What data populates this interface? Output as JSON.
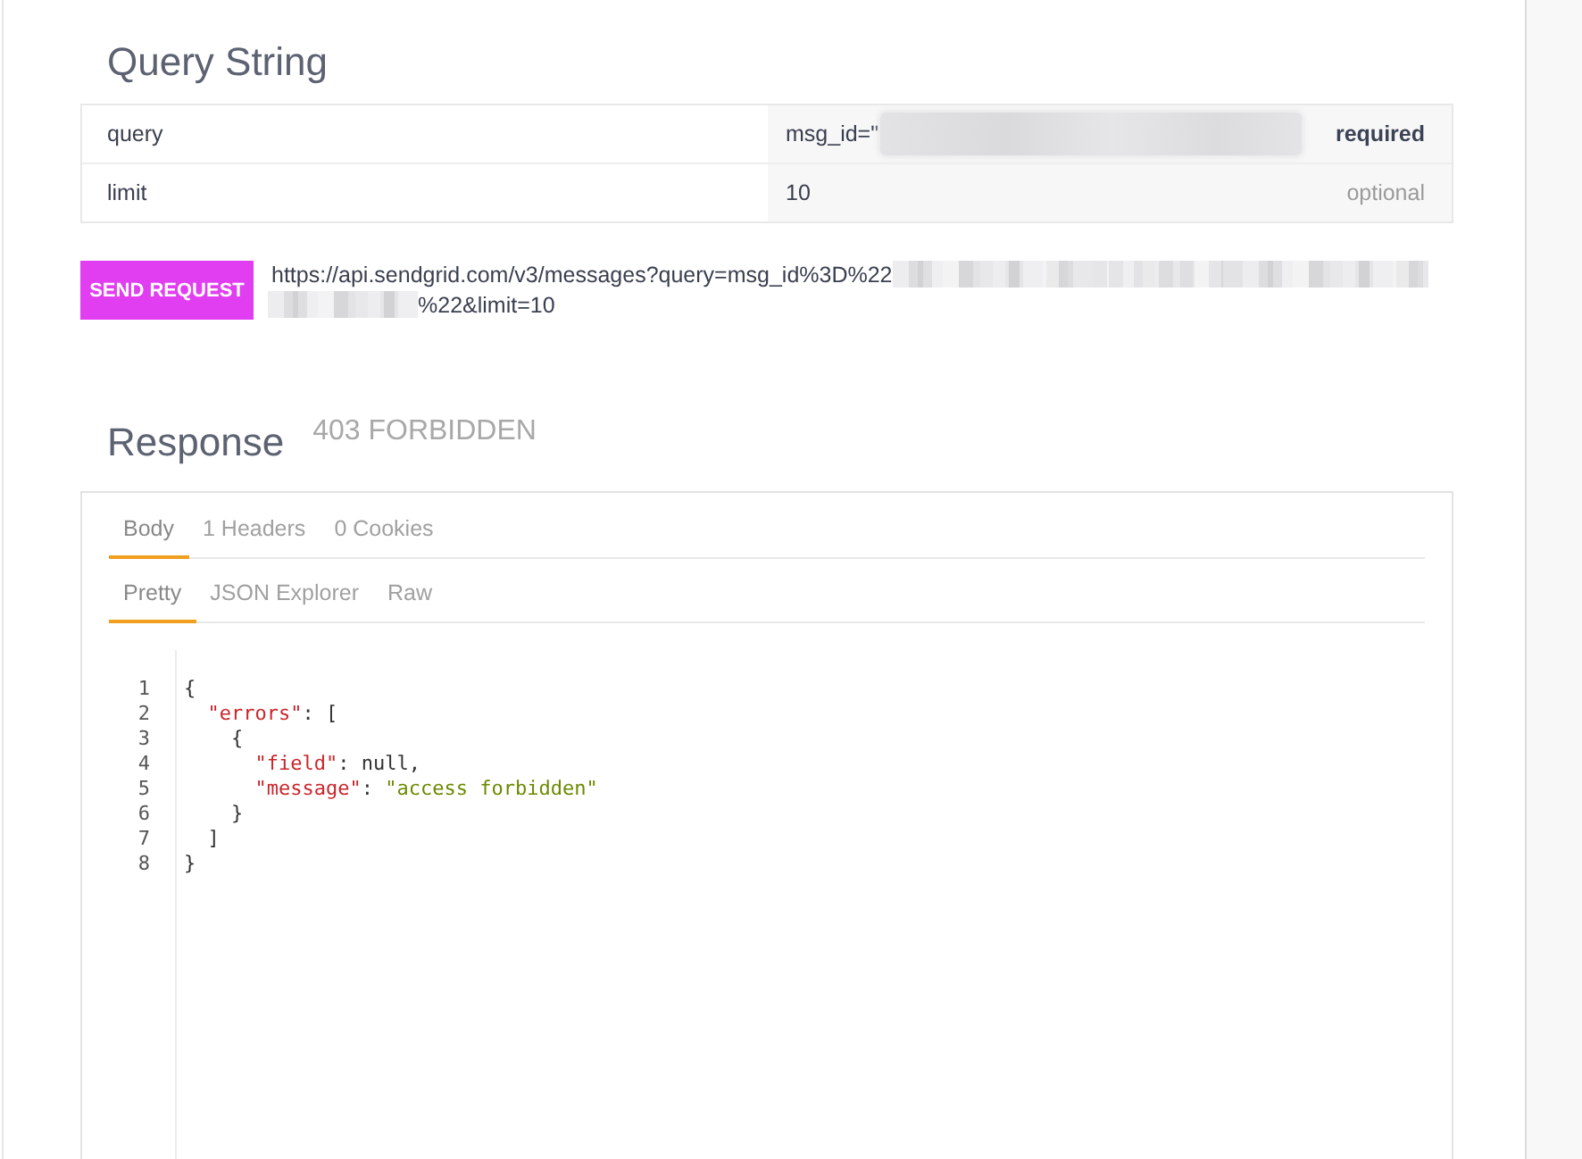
{
  "query_string": {
    "title": "Query String",
    "params": [
      {
        "name": "query",
        "value": "msg_id=\"",
        "redacted": true,
        "requirement": "required",
        "required": true
      },
      {
        "name": "limit",
        "value": "10",
        "redacted": false,
        "requirement": "optional",
        "required": false
      }
    ]
  },
  "request": {
    "button": "SEND REQUEST",
    "url_lines": [
      [
        {
          "kind": "text",
          "text": "https://api.sendgrid.com/v3/messages?query=msg_id%3D%22"
        },
        {
          "kind": "redacted"
        }
      ],
      [
        {
          "kind": "redacted"
        },
        {
          "kind": "text",
          "text": "%22&limit=10"
        }
      ]
    ]
  },
  "response": {
    "title": "Response",
    "status": "403 FORBIDDEN",
    "tabs": [
      {
        "label": "Body",
        "selected": true
      },
      {
        "label": "1 Headers",
        "selected": false
      },
      {
        "label": "0 Cookies",
        "selected": false
      }
    ],
    "view_tabs": [
      {
        "label": "Pretty",
        "selected": true
      },
      {
        "label": "JSON Explorer",
        "selected": false
      },
      {
        "label": "Raw",
        "selected": false
      }
    ],
    "code": {
      "lines": [
        {
          "number": "1",
          "tokens": [
            {
              "kind": "punct",
              "text": "{"
            }
          ]
        },
        {
          "number": "2",
          "tokens": [
            {
              "kind": "key",
              "text": "  \"errors\""
            },
            {
              "kind": "punct",
              "text": ": ["
            }
          ]
        },
        {
          "number": "3",
          "tokens": [
            {
              "kind": "punct",
              "text": "    {"
            }
          ]
        },
        {
          "number": "4",
          "tokens": [
            {
              "kind": "key",
              "text": "      \"field\""
            },
            {
              "kind": "punct",
              "text": ": null,"
            }
          ]
        },
        {
          "number": "5",
          "tokens": [
            {
              "kind": "key",
              "text": "      \"message\""
            },
            {
              "kind": "punct",
              "text": ": "
            },
            {
              "kind": "string",
              "text": "\"access forbidden\""
            }
          ]
        },
        {
          "number": "6",
          "tokens": [
            {
              "kind": "punct",
              "text": "    }"
            }
          ]
        },
        {
          "number": "7",
          "tokens": [
            {
              "kind": "punct",
              "text": "  ]"
            }
          ]
        },
        {
          "number": "8",
          "tokens": [
            {
              "kind": "punct",
              "text": "}"
            }
          ]
        }
      ]
    }
  }
}
